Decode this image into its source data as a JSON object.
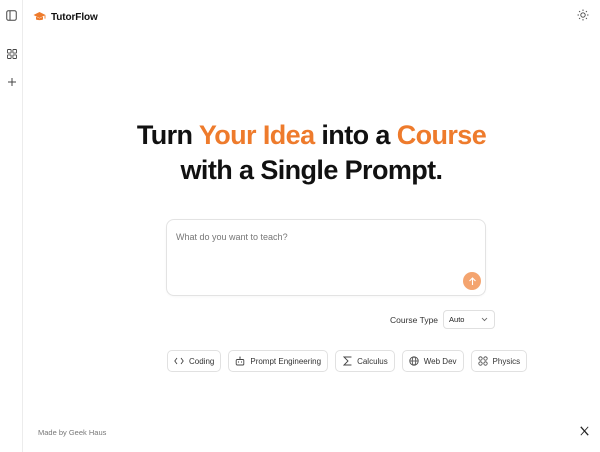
{
  "brand": {
    "name": "TutorFlow",
    "icon": "graduation-cap-icon",
    "accent_color": "#ee7b2c"
  },
  "sidebar": {
    "items": [
      {
        "icon": "sidebar-toggle-icon"
      },
      {
        "icon": "grid-icon"
      },
      {
        "icon": "plus-icon"
      }
    ]
  },
  "header": {
    "theme_icon": "sun-icon"
  },
  "hero": {
    "line1_part1": "Turn ",
    "line1_accent1": "Your Idea",
    "line1_part2": " into a ",
    "line1_accent2": "Course",
    "line2": "with a Single Prompt."
  },
  "prompt": {
    "placeholder": "What do you want to teach?",
    "value": "",
    "send_icon": "arrow-up-icon",
    "send_color": "#f4a46f"
  },
  "course_type": {
    "label": "Course Type",
    "selected": "Auto",
    "icon": "chevron-down-icon"
  },
  "suggestions": [
    {
      "label": "Coding",
      "icon": "code-icon"
    },
    {
      "label": "Prompt Engineering",
      "icon": "robot-icon"
    },
    {
      "label": "Calculus",
      "icon": "sigma-icon"
    },
    {
      "label": "Web Dev",
      "icon": "globe-icon"
    },
    {
      "label": "Physics",
      "icon": "atom-icon"
    }
  ],
  "footer": {
    "credit": "Made by Geek Haus",
    "social_icon": "x-logo-icon"
  }
}
